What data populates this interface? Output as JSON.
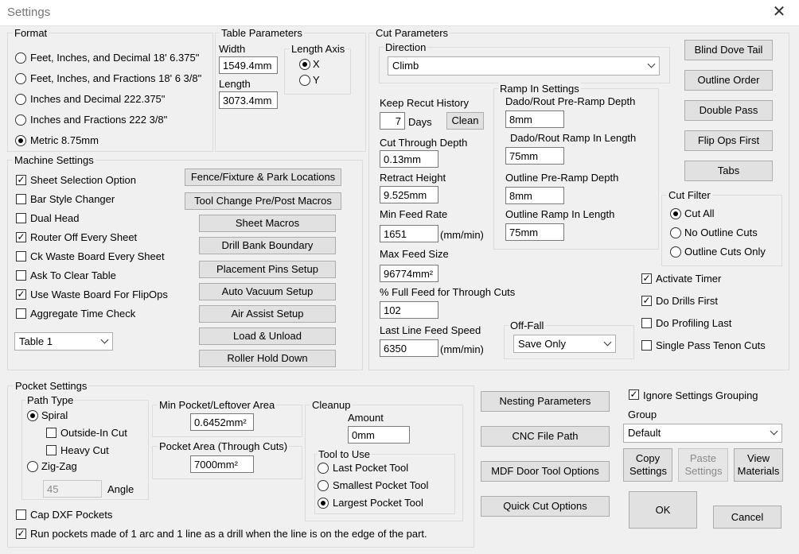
{
  "window": {
    "title": "Settings",
    "close_glyph": "✕"
  },
  "format": {
    "title": "Format",
    "options": [
      "Feet, Inches, and Decimal 18' 6.375\"",
      "Feet, Inches, and Fractions 18' 6 3/8\"",
      "Inches and Decimal 222.375\"",
      "Inches and Fractions 222 3/8\"",
      "Metric 8.75mm"
    ],
    "selected_index": 4
  },
  "table_params": {
    "title": "Table Parameters",
    "width_label": "Width",
    "width_value": "1549.4mm",
    "length_label": "Length",
    "length_value": "3073.4mm",
    "axis_title": "Length Axis",
    "axis_x": "X",
    "axis_y": "Y",
    "axis_selected": "X"
  },
  "machine": {
    "title": "Machine Settings",
    "checks": [
      {
        "label": "Sheet Selection Option",
        "checked": true
      },
      {
        "label": "Bar Style Changer",
        "checked": false
      },
      {
        "label": "Dual Head",
        "checked": false
      },
      {
        "label": "Router Off Every Sheet",
        "checked": true
      },
      {
        "label": "Ck Waste Board Every Sheet",
        "checked": false
      },
      {
        "label": "Ask To Clear Table",
        "checked": false
      },
      {
        "label": "Use Waste Board For FlipOps",
        "checked": true
      },
      {
        "label": "Aggregate Time Check",
        "checked": false
      }
    ],
    "table_select": "Table 1",
    "buttons": [
      "Fence/Fixture & Park Locations",
      "Tool Change Pre/Post Macros",
      "Sheet Macros",
      "Drill Bank Boundary",
      "Placement Pins Setup",
      "Auto Vacuum Setup",
      "Air Assist Setup",
      "Load & Unload",
      "Roller Hold Down"
    ]
  },
  "cut": {
    "title": "Cut Parameters",
    "direction_title": "Direction",
    "direction_value": "Climb",
    "keep_recut_label": "Keep Recut History",
    "keep_recut_value": "7",
    "days_label": "Days",
    "clean_button": "Clean",
    "cut_through_label": "Cut Through Depth",
    "cut_through_value": "0.13mm",
    "retract_label": "Retract Height",
    "retract_value": "9.525mm",
    "min_feed_label": "Min Feed Rate",
    "min_feed_value": "1651",
    "min_feed_unit": "(mm/min)",
    "max_feed_label": "Max Feed Size",
    "max_feed_value": "96774mm²",
    "pct_feed_label": "% Full Feed for Through Cuts",
    "pct_feed_value": "102",
    "last_line_label": "Last Line Feed Speed",
    "last_line_value": "6350",
    "last_line_unit": "(mm/min)",
    "ramp": {
      "title": "Ramp In Settings",
      "dado_pre_label": "Dado/Rout Pre-Ramp Depth",
      "dado_pre_value": "8mm",
      "dado_len_label": "Dado/Rout Ramp In Length",
      "dado_len_value": "75mm",
      "outline_pre_label": "Outline Pre-Ramp Depth",
      "outline_pre_value": "8mm",
      "outline_len_label": "Outline Ramp In Length",
      "outline_len_value": "75mm"
    },
    "offfall_title": "Off-Fall",
    "offfall_value": "Save Only"
  },
  "right_buttons": [
    "Blind Dove Tail",
    "Outline Order",
    "Double Pass",
    "Flip Ops First",
    "Tabs"
  ],
  "cut_filter": {
    "title": "Cut Filter",
    "options": [
      "Cut All",
      "No Outline Cuts",
      "Outline Cuts Only"
    ],
    "selected_index": 0
  },
  "right_checks": [
    {
      "label": "Activate Timer",
      "checked": true
    },
    {
      "label": "Do Drills First",
      "checked": true
    },
    {
      "label": "Do Profiling Last",
      "checked": false
    },
    {
      "label": "Single Pass Tenon Cuts",
      "checked": false
    }
  ],
  "pocket": {
    "title": "Pocket Settings",
    "path_type_title": "Path Type",
    "spiral_label": "Spiral",
    "spiral_selected": true,
    "outside_in_label": "Outside-In Cut",
    "outside_in_checked": false,
    "heavy_cut_label": "Heavy Cut",
    "heavy_cut_checked": false,
    "zigzag_label": "Zig-Zag",
    "zigzag_selected": false,
    "angle_value": "45",
    "angle_label": "Angle",
    "min_pocket_title": "Min Pocket/Leftover Area",
    "min_pocket_value": "0.6452mm²",
    "pocket_area_title": "Pocket Area (Through Cuts)",
    "pocket_area_value": "7000mm²",
    "cleanup_title": "Cleanup",
    "amount_label": "Amount",
    "amount_value": "0mm",
    "tool_title": "Tool to Use",
    "tool_options": [
      "Last Pocket Tool",
      "Smallest Pocket Tool",
      "Largest Pocket Tool"
    ],
    "tool_selected_index": 2,
    "cap_dxf_label": "Cap DXF Pockets",
    "cap_dxf_checked": false,
    "run_pockets_label": "Run pockets made of 1 arc and 1 line as a drill when the line is on the edge of the part.",
    "run_pockets_checked": true
  },
  "bottom_buttons": [
    "Nesting Parameters",
    "CNC File Path",
    "MDF Door Tool Options",
    "Quick Cut Options"
  ],
  "ignore_grouping_label": "Ignore Settings Grouping",
  "ignore_grouping_checked": true,
  "group_label": "Group",
  "group_value": "Default",
  "copy_settings": "Copy Settings",
  "paste_settings": "Paste Settings",
  "view_materials": "View Materials",
  "ok": "OK",
  "cancel": "Cancel"
}
